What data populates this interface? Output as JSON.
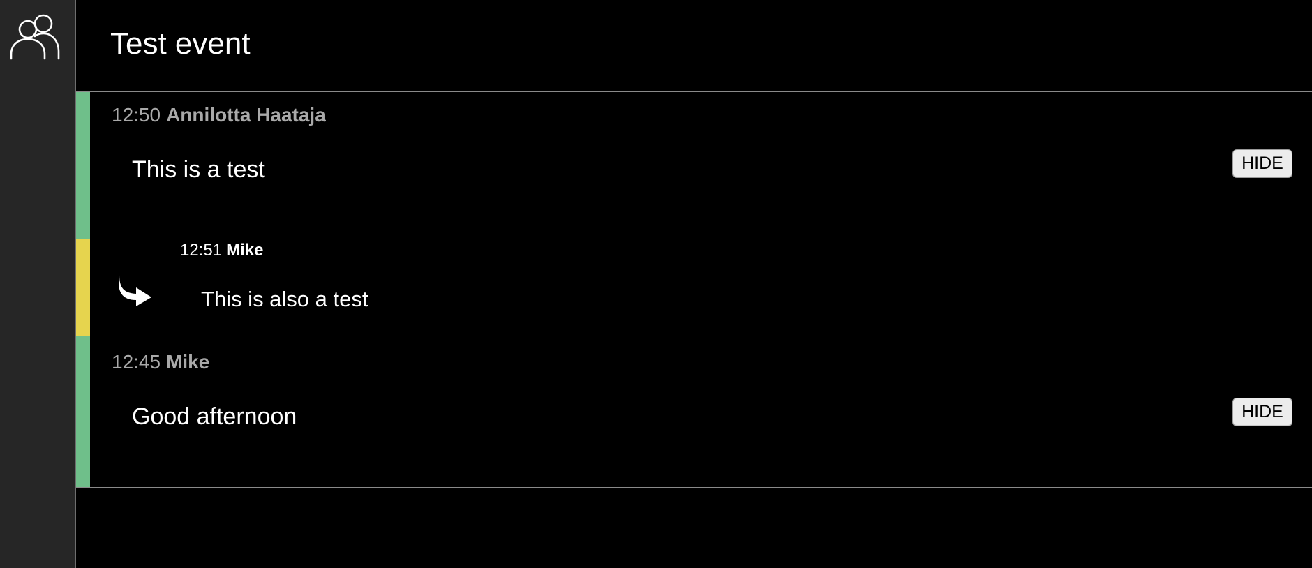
{
  "sidebar": {
    "icon": "users-group-icon"
  },
  "header": {
    "title": "Test event"
  },
  "messages": [
    {
      "time": "12:50",
      "author": "Annilotta Haataja",
      "text": "This is a test",
      "hide_label": "HIDE",
      "status_color": "#6fbf8a"
    },
    {
      "time": "12:45",
      "author": "Mike",
      "text": "Good afternoon",
      "hide_label": "HIDE",
      "status_color": "#6fbf8a"
    }
  ],
  "reply": {
    "time": "12:51",
    "author": "Mike",
    "text": "This is also a test",
    "icon": "reply-arrow-icon",
    "status_color": "#e6d44e"
  }
}
